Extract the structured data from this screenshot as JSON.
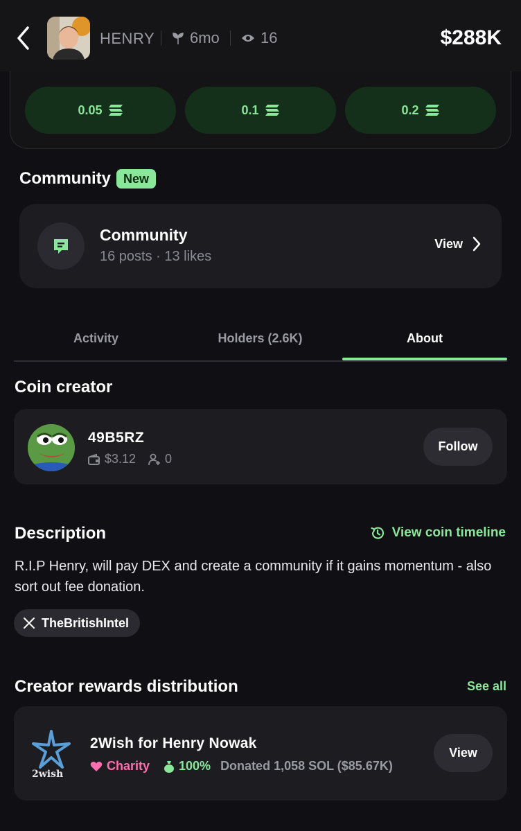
{
  "header": {
    "token_name": "HENRY",
    "age": "6mo",
    "views": "16",
    "market_cap": "$288K"
  },
  "quick_buy": [
    {
      "amount": "0.05"
    },
    {
      "amount": "0.1"
    },
    {
      "amount": "0.2"
    }
  ],
  "community": {
    "section_title": "Community",
    "badge": "New",
    "card_title": "Community",
    "card_subtitle": "16 posts · 13 likes",
    "view_label": "View"
  },
  "tabs": [
    {
      "label": "Activity",
      "active": false
    },
    {
      "label": "Holders (2.6K)",
      "active": false
    },
    {
      "label": "About",
      "active": true
    }
  ],
  "creator": {
    "section_title": "Coin creator",
    "name": "49B5RZ",
    "balance": "$3.12",
    "followers": "0",
    "follow_label": "Follow"
  },
  "description": {
    "section_title": "Description",
    "timeline_label": "View coin timeline",
    "text": "R.I.P Henry, will pay DEX and create a community if it gains momentum - also sort out fee donation.",
    "social_handle": "TheBritishIntel"
  },
  "rewards": {
    "section_title": "Creator rewards distribution",
    "see_all_label": "See all",
    "logo_text": "2wish",
    "name": "2Wish for Henry Nowak",
    "category": "Charity",
    "percent": "100%",
    "donated": "Donated 1,058 SOL ($85.67K)",
    "view_label": "View"
  },
  "colors": {
    "accent_green": "#8ae79a",
    "charity_pink": "#ff6fb0",
    "background": "#101014",
    "card": "#1c1c21"
  }
}
